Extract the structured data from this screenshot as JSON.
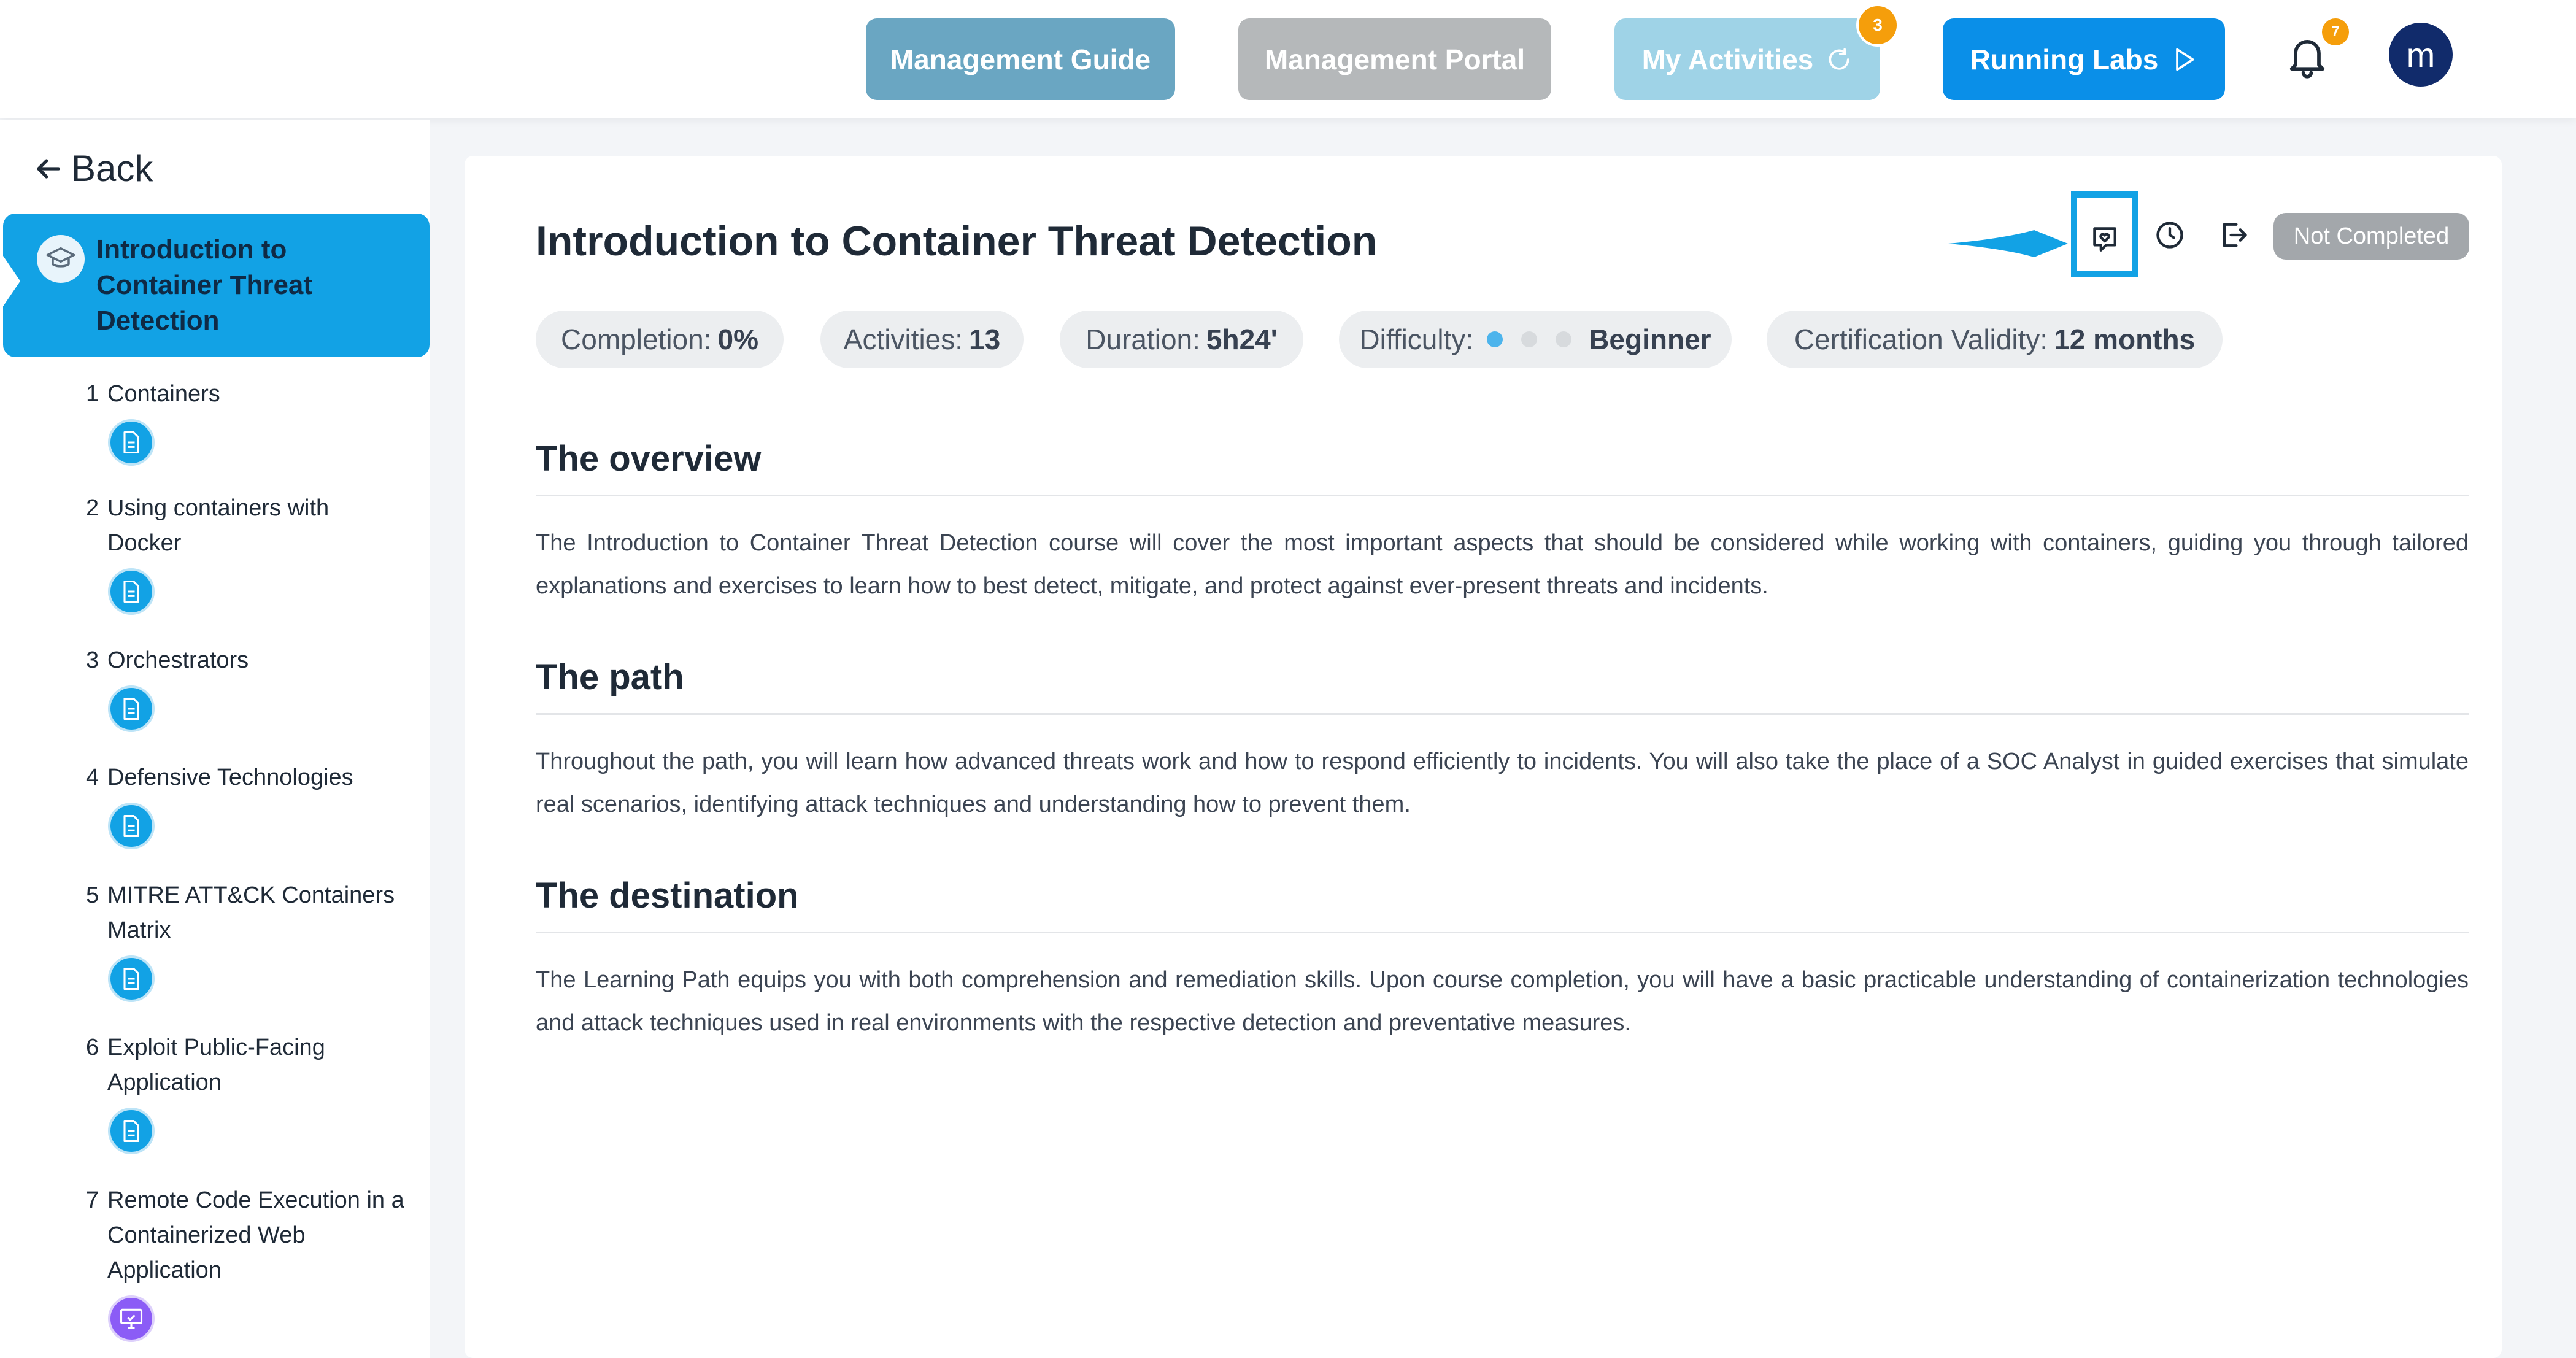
{
  "header": {
    "management_guide": "Management Guide",
    "management_portal": "Management Portal",
    "my_activities": "My Activities",
    "my_activities_badge": "3",
    "running_labs": "Running Labs",
    "notifications_badge": "7",
    "avatar_initial": "m",
    "colors": {
      "guide": "#6aa6c2",
      "portal": "#b5b8ba",
      "activities": "#9fd3e7",
      "labs": "#0a8fe8",
      "badge": "#f59e0b"
    }
  },
  "sidebar": {
    "back_label": "Back",
    "course_title": "Introduction to Container Threat Detection",
    "modules": [
      {
        "num": "1",
        "label": "Containers",
        "icon": "document-icon"
      },
      {
        "num": "2",
        "label": "Using containers with Docker",
        "icon": "document-icon"
      },
      {
        "num": "3",
        "label": "Orchestrators",
        "icon": "document-icon"
      },
      {
        "num": "4",
        "label": "Defensive Technologies",
        "icon": "document-icon"
      },
      {
        "num": "5",
        "label": "MITRE ATT&CK Containers Matrix",
        "icon": "document-icon"
      },
      {
        "num": "6",
        "label": "Exploit Public-Facing Application",
        "icon": "document-icon"
      },
      {
        "num": "7",
        "label": "Remote Code Execution in a Containerized Web Application",
        "icon": "lab-monitor-icon"
      }
    ]
  },
  "main": {
    "title": "Introduction to Container Threat Detection",
    "status": "Not Completed",
    "stats": {
      "completion_label": "Completion:",
      "completion_value": "0%",
      "activities_label": "Activities:",
      "activities_value": "13",
      "duration_label": "Duration:",
      "duration_value": "5h24'",
      "difficulty_label": "Difficulty:",
      "difficulty_value": "Beginner",
      "difficulty_level": 1,
      "difficulty_max": 3,
      "validity_label": "Certification Validity:",
      "validity_value": "12 months"
    },
    "sections": [
      {
        "heading": "The overview",
        "text": "The Introduction to Container Threat Detection course will cover the most important aspects that should be considered while working with containers, guiding you through tailored explanations and exercises to learn how to best detect, mitigate, and protect against ever-present threats and incidents."
      },
      {
        "heading": "The path",
        "text": "Throughout the path, you will learn how advanced threats work and how to respond efficiently to incidents. You will also take the place of a SOC Analyst in guided exercises that simulate real scenarios, identifying attack techniques and understanding how to prevent them."
      },
      {
        "heading": "The destination",
        "text": "The Learning Path equips you with both comprehension and remediation skills. Upon course completion, you will have a basic practicable understanding of containerization technologies and attack techniques used in real environments with the respective detection and preventative measures."
      }
    ],
    "colors": {
      "accent": "#12a2e5",
      "status_bg": "#a3a7ab"
    }
  }
}
